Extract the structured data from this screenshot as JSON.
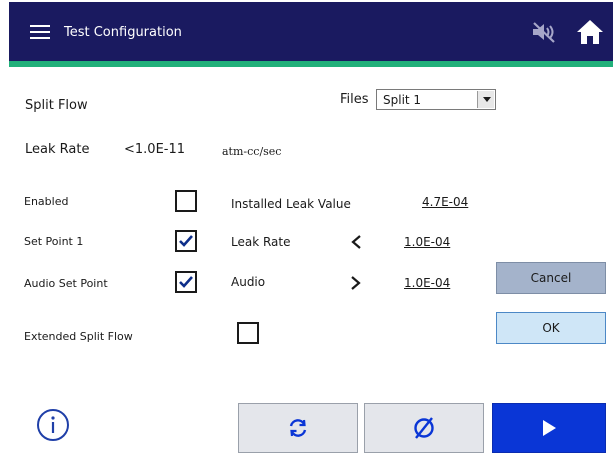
{
  "header": {
    "title": "Test Configuration",
    "menu_icon": "hamburger-menu-icon",
    "mute_icon": "speaker-mute-icon",
    "home_icon": "home-icon",
    "colors": {
      "background": "#1a1a60",
      "accent_stripe": "#21b07a"
    }
  },
  "section": {
    "title": "Split Flow"
  },
  "files": {
    "label": "Files",
    "selected": "Split 1"
  },
  "leak_rate_row": {
    "label": "Leak Rate",
    "value": "<1.0E-11",
    "unit": "atm-cc/sec"
  },
  "options": {
    "enabled": {
      "label": "Enabled",
      "checked": false
    },
    "set_point_1": {
      "label": "Set Point 1",
      "checked": true
    },
    "audio_set_point": {
      "label": "Audio Set Point",
      "checked": true
    },
    "extended_split_flow": {
      "label": "Extended Split Flow",
      "checked": false
    }
  },
  "values": {
    "installed_leak": {
      "label": "Installed Leak Value",
      "value": "4.7E-04"
    },
    "leak_rate": {
      "label": "Leak Rate",
      "comparator_icon": "less-than-chevron-icon",
      "value": "1.0E-04"
    },
    "audio": {
      "label": "Audio",
      "comparator_icon": "greater-than-chevron-icon",
      "value": "1.0E-04"
    }
  },
  "buttons": {
    "cancel": "Cancel",
    "ok": "OK",
    "info_icon": "info-icon",
    "refresh_icon": "refresh-icon",
    "clear_icon": "clear-null-icon",
    "play_icon": "play-icon",
    "colors": {
      "play": "#0a36d6",
      "cancel": "#a4b3cb",
      "ok": "#cfe6f7"
    }
  }
}
